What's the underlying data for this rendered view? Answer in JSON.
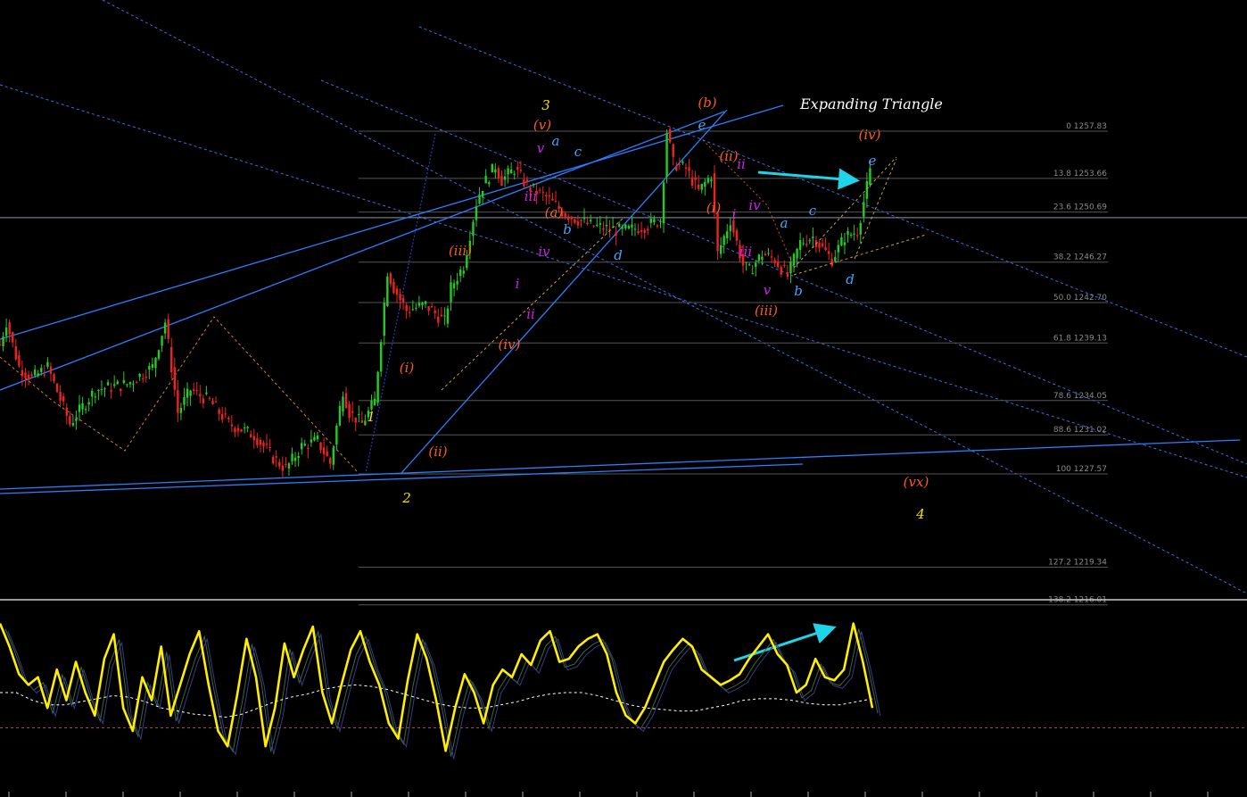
{
  "colors": {
    "background": "#000000",
    "bull_candle": "#22cc22",
    "bear_candle": "#ee2222",
    "trendline": "#2a7fff",
    "channel_dotted": "#3d6ee8",
    "fib_line": "#555555",
    "fib_text": "#8a8a8a",
    "triangle_dashed": "#c8a040",
    "arrow": "#1fd3e8",
    "osc_main": "#ffee00",
    "osc_signal": "#ffffff",
    "osc_zero": "#b03a6a",
    "wave_yellow": "#f0e000",
    "wave_orange": "#ff5a1a",
    "wave_magenta": "#d020e8",
    "wave_blue": "#40a8ff"
  },
  "annotation_title": "Expanding Triangle",
  "chart_data": [
    {
      "type": "line",
      "kind": "candlestick",
      "ylim": [
        1216.0,
        1262.0
      ],
      "grid": false,
      "horizontal_line_level": 1250.2,
      "fib_levels": [
        {
          "label": "0 1257.83",
          "value": 1257.83
        },
        {
          "label": "13.8 1253.66",
          "value": 1253.66
        },
        {
          "label": "23.6 1250.69",
          "value": 1250.69
        },
        {
          "label": "38.2 1246.27",
          "value": 1246.27
        },
        {
          "label": "50.0 1242.70",
          "value": 1242.7
        },
        {
          "label": "61.8 1239.13",
          "value": 1239.13
        },
        {
          "label": "78.6 1234.05",
          "value": 1234.05
        },
        {
          "label": "88.6 1231.02",
          "value": 1231.02
        },
        {
          "label": "100 1227.57",
          "value": 1227.57
        },
        {
          "label": "127.2 1219.34",
          "value": 1219.34
        },
        {
          "label": "138.2 1216.01",
          "value": 1216.01
        }
      ],
      "path_points": [
        [
          0,
          1239
        ],
        [
          2,
          1241
        ],
        [
          6,
          1237
        ],
        [
          10,
          1236
        ],
        [
          15,
          1237
        ],
        [
          22,
          1232
        ],
        [
          30,
          1235
        ],
        [
          40,
          1235.5
        ],
        [
          48,
          1237
        ],
        [
          52,
          1241
        ],
        [
          56,
          1233
        ],
        [
          60,
          1235
        ],
        [
          66,
          1234
        ],
        [
          72,
          1232
        ],
        [
          80,
          1231
        ],
        [
          86,
          1229
        ],
        [
          90,
          1228
        ],
        [
          95,
          1230
        ],
        [
          100,
          1230.5
        ],
        [
          104,
          1228.5
        ],
        [
          108,
          1235
        ],
        [
          110,
          1233
        ],
        [
          114,
          1232
        ],
        [
          118,
          1234
        ],
        [
          122,
          1245.5
        ],
        [
          124,
          1244
        ],
        [
          128,
          1242
        ],
        [
          134,
          1242.5
        ],
        [
          140,
          1241
        ],
        [
          142,
          1244
        ],
        [
          146,
          1246
        ],
        [
          150,
          1251.5
        ],
        [
          152,
          1253
        ],
        [
          156,
          1254.8
        ],
        [
          158,
          1253.5
        ],
        [
          162,
          1254.5
        ],
        [
          166,
          1253
        ],
        [
          172,
          1252
        ],
        [
          178,
          1250.5
        ],
        [
          186,
          1249.5
        ],
        [
          196,
          1249
        ],
        [
          204,
          1249.5
        ],
        [
          208,
          1250
        ],
        [
          210,
          1257.8
        ],
        [
          212,
          1255
        ],
        [
          216,
          1254.5
        ],
        [
          220,
          1252.5
        ],
        [
          224,
          1254
        ],
        [
          226,
          1247
        ],
        [
          230,
          1250
        ],
        [
          234,
          1246
        ],
        [
          236,
          1245.5
        ],
        [
          240,
          1247
        ],
        [
          244,
          1246.5
        ],
        [
          248,
          1245
        ],
        [
          252,
          1248
        ],
        [
          256,
          1248.5
        ],
        [
          262,
          1246.5
        ],
        [
          266,
          1248.5
        ],
        [
          270,
          1249
        ],
        [
          274,
          1254.2
        ]
      ],
      "candle_count": 275
    },
    {
      "type": "line",
      "kind": "oscillator",
      "ylim": [
        0,
        100
      ],
      "zero_line_value": 27,
      "signal_series": [
        50,
        50,
        45,
        42,
        42,
        44,
        46,
        48,
        47,
        44,
        40,
        38,
        36,
        35,
        34,
        36,
        40,
        44,
        47,
        49,
        52,
        54,
        55,
        54,
        52,
        49,
        46,
        43,
        41,
        40,
        40,
        42,
        44,
        47,
        49,
        50,
        50,
        48,
        45,
        42,
        40,
        39,
        38,
        38,
        40,
        42,
        45,
        46,
        46,
        45,
        43,
        42,
        42,
        44,
        46
      ],
      "main_series": [
        95,
        80,
        62,
        55,
        60,
        40,
        65,
        45,
        70,
        50,
        35,
        72,
        88,
        40,
        25,
        60,
        45,
        80,
        35,
        55,
        75,
        90,
        55,
        25,
        15,
        48,
        85,
        60,
        15,
        40,
        82,
        60,
        78,
        93,
        50,
        30,
        55,
        78,
        90,
        70,
        55,
        30,
        20,
        58,
        88,
        72,
        45,
        12,
        40,
        62,
        50,
        30,
        55,
        65,
        60,
        75,
        68,
        84,
        90,
        70,
        72,
        80,
        85,
        88,
        75,
        50,
        35,
        30,
        40,
        55,
        70,
        78,
        85,
        80,
        65,
        60,
        55,
        58,
        62,
        72,
        80,
        88,
        75,
        68,
        50,
        55,
        72,
        60,
        58,
        65,
        95,
        70,
        40
      ],
      "series": [
        {
          "name": "",
          "values": [
            95,
            80,
            62,
            55,
            60,
            40,
            65,
            45,
            70,
            50,
            35,
            72,
            88,
            40,
            25,
            60,
            45,
            80,
            35,
            55,
            75,
            90,
            55,
            25,
            15,
            48,
            85,
            60,
            15,
            40,
            82,
            60,
            78,
            93,
            50,
            30,
            55,
            78,
            90,
            70,
            55,
            30,
            20,
            58,
            88,
            72,
            45,
            12,
            40,
            62,
            50,
            30,
            55,
            65,
            60,
            75,
            68,
            84,
            90,
            70,
            72,
            80,
            85,
            88,
            75,
            50,
            35,
            30,
            40,
            55,
            70,
            78,
            85,
            80,
            65,
            60,
            55,
            58,
            62,
            72,
            80,
            88,
            75,
            68,
            50,
            55,
            72,
            60,
            58,
            65,
            95,
            70,
            40
          ]
        }
      ]
    }
  ],
  "wave_labels": [
    {
      "text": "1",
      "color_key": "wave_yellow"
    },
    {
      "text": "2",
      "color_key": "wave_yellow"
    },
    {
      "text": "3",
      "color_key": "wave_yellow"
    },
    {
      "text": "4",
      "color_key": "wave_yellow"
    },
    {
      "text": "(i)",
      "color_key": "wave_orange"
    },
    {
      "text": "(ii)",
      "color_key": "wave_orange"
    },
    {
      "text": "(iii)",
      "color_key": "wave_orange"
    },
    {
      "text": "(iv)",
      "color_key": "wave_orange"
    },
    {
      "text": "(v)",
      "color_key": "wave_orange"
    },
    {
      "text": "(a)",
      "color_key": "wave_orange"
    },
    {
      "text": "(b)",
      "color_key": "wave_orange"
    },
    {
      "text": "(i)",
      "color_key": "wave_orange"
    },
    {
      "text": "(ii)",
      "color_key": "wave_orange"
    },
    {
      "text": "(iii)",
      "color_key": "wave_orange"
    },
    {
      "text": "(iv)",
      "color_key": "wave_orange"
    },
    {
      "text": "(vx)",
      "color_key": "wave_orange"
    },
    {
      "text": "i",
      "color_key": "wave_magenta"
    },
    {
      "text": "ii",
      "color_key": "wave_magenta"
    },
    {
      "text": "iii",
      "color_key": "wave_magenta"
    },
    {
      "text": "iv",
      "color_key": "wave_magenta"
    },
    {
      "text": "v",
      "color_key": "wave_magenta"
    },
    {
      "text": "i",
      "color_key": "wave_magenta"
    },
    {
      "text": "ii",
      "color_key": "wave_magenta"
    },
    {
      "text": "iii",
      "color_key": "wave_magenta"
    },
    {
      "text": "iv",
      "color_key": "wave_magenta"
    },
    {
      "text": "v",
      "color_key": "wave_magenta"
    },
    {
      "text": "a",
      "color_key": "wave_blue"
    },
    {
      "text": "b",
      "color_key": "wave_blue"
    },
    {
      "text": "c",
      "color_key": "wave_blue"
    },
    {
      "text": "d",
      "color_key": "wave_blue"
    },
    {
      "text": "e",
      "color_key": "wave_blue"
    },
    {
      "text": "a",
      "color_key": "wave_blue"
    },
    {
      "text": "b",
      "color_key": "wave_blue"
    },
    {
      "text": "c",
      "color_key": "wave_blue"
    },
    {
      "text": "d",
      "color_key": "wave_blue"
    },
    {
      "text": "e",
      "color_key": "wave_blue"
    }
  ]
}
